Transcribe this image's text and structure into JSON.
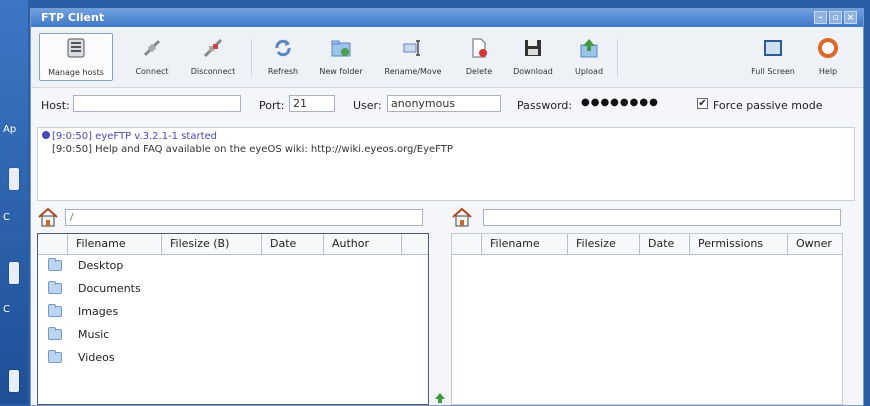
{
  "window": {
    "title": "FTP Client",
    "minimize": "–",
    "maximize": "▫",
    "close": "×"
  },
  "toolbar": {
    "manage_hosts": "Manage hosts",
    "connect": "Connect",
    "disconnect": "Disconnect",
    "refresh": "Refresh",
    "new_folder": "New folder",
    "rename_move": "Rename/Move",
    "delete": "Delete",
    "download": "Download",
    "upload": "Upload",
    "full_screen": "Full Screen",
    "help": "Help"
  },
  "connection": {
    "host_label": "Host:",
    "host_value": "",
    "port_label": "Port:",
    "port_value": "21",
    "user_label": "User:",
    "user_value": "anonymous",
    "password_label": "Password:",
    "password_value": "●●●●●●●●",
    "passive_label": "Force passive mode",
    "passive_checked": "✔"
  },
  "log": [
    "[9:0:50] eyeFTP v.3.2.1-1 started",
    "[9:0:50] Help and FAQ available on the eyeOS wiki: http://wiki.eyeos.org/EyeFTP"
  ],
  "local": {
    "path": "/",
    "columns": [
      "Filename",
      "Filesize (B)",
      "Date",
      "Author"
    ],
    "items": [
      "Desktop",
      "Documents",
      "Images",
      "Music",
      "Videos"
    ]
  },
  "remote": {
    "path": "",
    "columns": [
      "Filename",
      "Filesize",
      "Date",
      "Permissions",
      "Owner"
    ]
  },
  "desktop": {
    "labels": [
      "Ap",
      "C",
      "C"
    ]
  }
}
